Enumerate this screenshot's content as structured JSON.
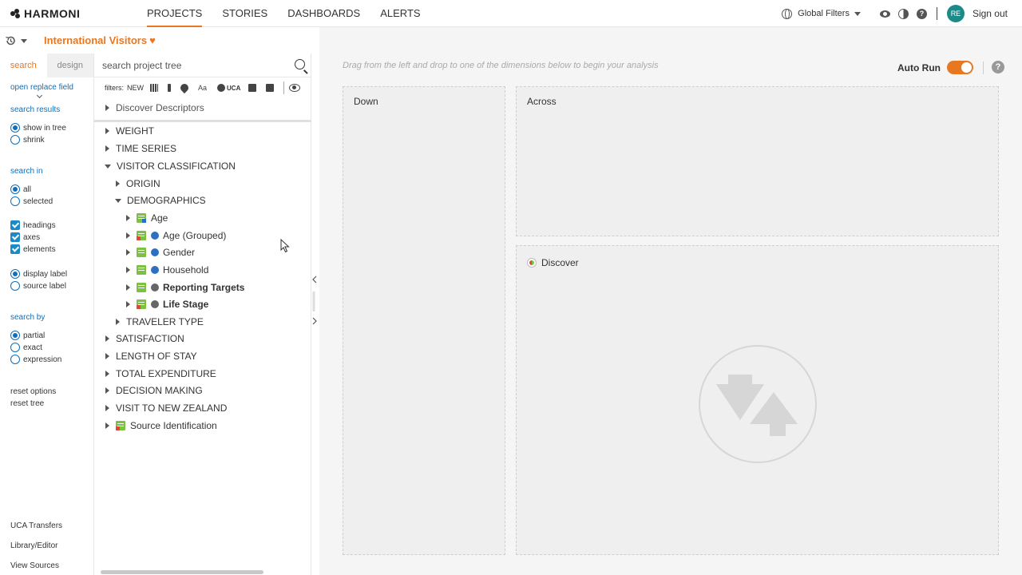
{
  "app": {
    "logo_text": "HARMONI"
  },
  "nav": {
    "items": [
      {
        "label": "PROJECTS",
        "active": true
      },
      {
        "label": "STORIES",
        "active": false
      },
      {
        "label": "DASHBOARDS",
        "active": false
      },
      {
        "label": "ALERTS",
        "active": false
      }
    ]
  },
  "topright": {
    "global_filters": "Global Filters",
    "avatar_initials": "RE",
    "sign_out": "Sign out"
  },
  "project": {
    "title": "International Visitors",
    "heart": "♥"
  },
  "options": {
    "tabs": [
      {
        "label": "search",
        "active": true
      },
      {
        "label": "design",
        "active": false
      }
    ],
    "open_replace_field": "open replace field",
    "search_results_head": "search results",
    "search_results": [
      {
        "label": "show in tree",
        "selected": true
      },
      {
        "label": "shrink",
        "selected": false
      }
    ],
    "search_in_head": "search in",
    "search_in": [
      {
        "label": "all",
        "selected": true
      },
      {
        "label": "selected",
        "selected": false
      }
    ],
    "checks": [
      {
        "label": "headings",
        "checked": true
      },
      {
        "label": "axes",
        "checked": true
      },
      {
        "label": "elements",
        "checked": true
      }
    ],
    "label_mode": [
      {
        "label": "display label",
        "selected": true
      },
      {
        "label": "source label",
        "selected": false
      }
    ],
    "search_by_head": "search by",
    "search_by": [
      {
        "label": "partial",
        "selected": true
      },
      {
        "label": "exact",
        "selected": false
      },
      {
        "label": "expression",
        "selected": false
      }
    ],
    "reset_options": "reset options",
    "reset_tree": "reset tree",
    "footer_links": [
      "UCA Transfers",
      "Library/Editor",
      "View Sources"
    ]
  },
  "tree": {
    "search_placeholder": "search project tree",
    "filters_label": "filters:",
    "filters_new": "NEW",
    "filters_uca": "UCA",
    "descriptor": "Discover Descriptors",
    "rows": [
      {
        "label": "WEIGHT",
        "expanded": false
      },
      {
        "label": "TIME SERIES",
        "expanded": false
      },
      {
        "label": "VISITOR CLASSIFICATION",
        "expanded": true
      },
      {
        "label": "ORIGIN",
        "expanded": false
      },
      {
        "label": "DEMOGRAPHICS",
        "expanded": true
      },
      {
        "label": "Age",
        "expanded": false
      },
      {
        "label": "Age (Grouped)",
        "expanded": false
      },
      {
        "label": "Gender",
        "expanded": false
      },
      {
        "label": "Household",
        "expanded": false
      },
      {
        "label": "Reporting Targets",
        "expanded": false
      },
      {
        "label": "Life Stage",
        "expanded": false
      },
      {
        "label": "TRAVELER TYPE",
        "expanded": false
      },
      {
        "label": "SATISFACTION",
        "expanded": false
      },
      {
        "label": "LENGTH OF STAY",
        "expanded": false
      },
      {
        "label": "TOTAL EXPENDITURE",
        "expanded": false
      },
      {
        "label": "DECISION MAKING",
        "expanded": false
      },
      {
        "label": "VISIT TO NEW ZEALAND",
        "expanded": false
      },
      {
        "label": "Source Identification",
        "expanded": false
      }
    ]
  },
  "workspace": {
    "hint": "Drag from the left and drop to one of the dimensions below to begin your analysis",
    "auto_run_label": "Auto Run",
    "auto_run_on": true,
    "zones": {
      "down": "Down",
      "across": "Across",
      "discover": "Discover"
    }
  },
  "colors": {
    "accent": "#e87722",
    "link": "#0f6fba",
    "var_green": "#7cc142",
    "avatar": "#1d8a8a"
  }
}
